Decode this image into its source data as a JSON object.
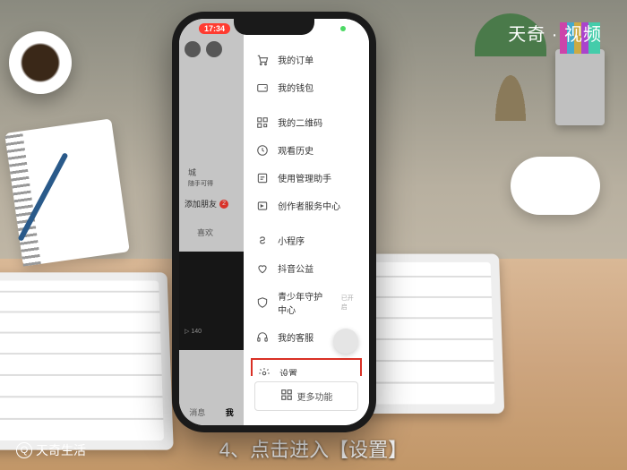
{
  "brand": {
    "topRight": "天奇 · 视频",
    "bottomLeft": "天奇生活"
  },
  "caption": "4、点击进入【设置】",
  "statusbar": {
    "time": "17:34"
  },
  "leftPanel": {
    "midText": "城",
    "midSub": "随手可得",
    "addFriend": "添加朋友",
    "addBadge": "2",
    "like": "喜欢",
    "playCount": "▷ 140",
    "tabs": [
      "消息",
      "我"
    ]
  },
  "menu": [
    {
      "icon": "cart",
      "label": "我的订单"
    },
    {
      "icon": "wallet",
      "label": "我的钱包"
    },
    {
      "icon": "qr",
      "label": "我的二维码"
    },
    {
      "icon": "clock",
      "label": "观看历史"
    },
    {
      "icon": "admin",
      "label": "使用管理助手"
    },
    {
      "icon": "creator",
      "label": "创作者服务中心"
    },
    {
      "icon": "mini",
      "label": "小程序"
    },
    {
      "icon": "charity",
      "label": "抖音公益"
    },
    {
      "icon": "shield",
      "label": "青少年守护中心",
      "sub": "已开启"
    },
    {
      "icon": "service",
      "label": "我的客服"
    },
    {
      "icon": "gear",
      "label": "设置",
      "highlight": true
    }
  ],
  "moreButton": "更多功能"
}
